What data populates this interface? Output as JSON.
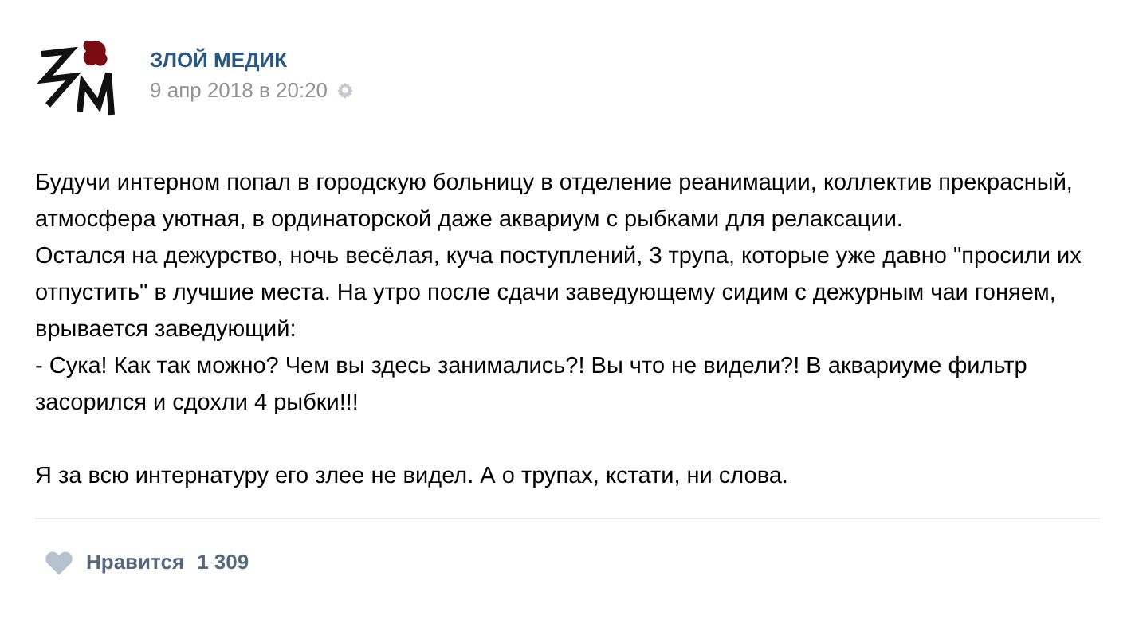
{
  "post": {
    "author": "ЗЛОЙ МЕДИК",
    "date": "9 апр 2018 в 20:20",
    "text_blocks": [
      [
        "Будучи интерном попал в городскую больницу в отделение реанимации, коллектив прекрасный, атмосфера уютная, в ординаторской даже аквариум с рыбками для релаксации.",
        "Остался на дежурство, ночь весёлая, куча поступлений, 3 трупа, которые уже давно \"просили их отпустить\" в лучшие места. На утро после сдачи заведующему сидим с дежурным чаи гоняем, врывается заведующий:",
        "- Сука! Как так можно? Чем вы здесь занимались?! Вы что не видели?! В аквариуме фильтр засорился и сдохли 4 рыбки!!!"
      ],
      [
        "Я за всю интернатуру его злее не видел. А о трупах, кстати, ни слова."
      ]
    ],
    "like": {
      "label": "Нравится",
      "count": "1 309",
      "liked": false
    }
  }
}
